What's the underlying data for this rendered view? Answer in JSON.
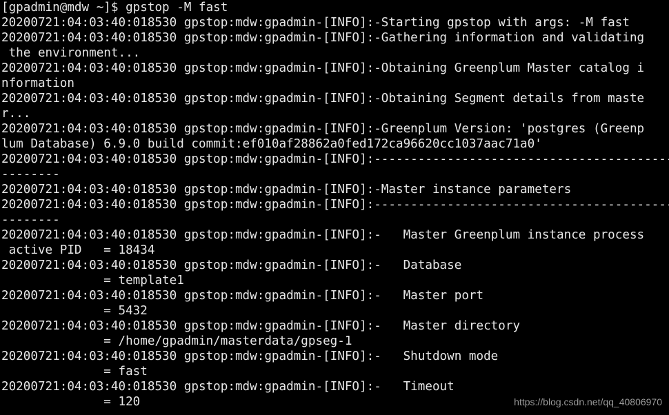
{
  "terminal": {
    "lines": [
      "[gpadmin@mdw ~]$ gpstop -M fast",
      "20200721:04:03:40:018530 gpstop:mdw:gpadmin-[INFO]:-Starting gpstop with args: -M fast",
      "20200721:04:03:40:018530 gpstop:mdw:gpadmin-[INFO]:-Gathering information and validating",
      " the environment...",
      "20200721:04:03:40:018530 gpstop:mdw:gpadmin-[INFO]:-Obtaining Greenplum Master catalog i",
      "nformation",
      "20200721:04:03:40:018530 gpstop:mdw:gpadmin-[INFO]:-Obtaining Segment details from maste",
      "r...",
      "20200721:04:03:40:018530 gpstop:mdw:gpadmin-[INFO]:-Greenplum Version: 'postgres (Greenp",
      "lum Database) 6.9.0 build commit:ef010af28862a0fed172ca96620cc1037aac71a0'",
      "20200721:04:03:40:018530 gpstop:mdw:gpadmin-[INFO]:-----------------------------------------",
      "--------",
      "20200721:04:03:40:018530 gpstop:mdw:gpadmin-[INFO]:-Master instance parameters",
      "20200721:04:03:40:018530 gpstop:mdw:gpadmin-[INFO]:-----------------------------------------",
      "--------",
      "20200721:04:03:40:018530 gpstop:mdw:gpadmin-[INFO]:-   Master Greenplum instance process",
      " active PID   = 18434",
      "20200721:04:03:40:018530 gpstop:mdw:gpadmin-[INFO]:-   Database",
      "              = template1",
      "20200721:04:03:40:018530 gpstop:mdw:gpadmin-[INFO]:-   Master port",
      "              = 5432",
      "20200721:04:03:40:018530 gpstop:mdw:gpadmin-[INFO]:-   Master directory",
      "              = /home/gpadmin/masterdata/gpseg-1",
      "20200721:04:03:40:018530 gpstop:mdw:gpadmin-[INFO]:-   Shutdown mode",
      "              = fast",
      "20200721:04:03:40:018530 gpstop:mdw:gpadmin-[INFO]:-   Timeout",
      "              = 120"
    ]
  },
  "watermark": "https://blog.csdn.net/qq_40806970",
  "colors": {
    "background": "#000000",
    "text": "#e6e6e6",
    "watermark": "#9a9a9a"
  }
}
